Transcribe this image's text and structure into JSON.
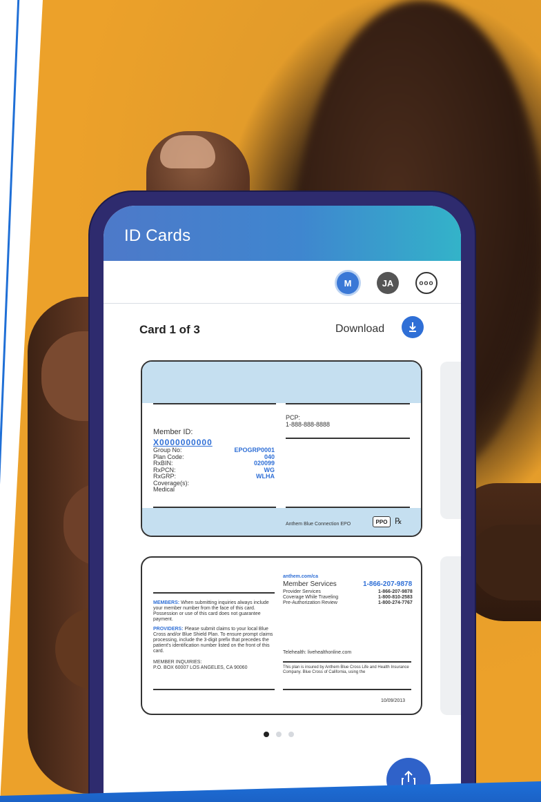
{
  "app": {
    "title": "ID Cards"
  },
  "members": {
    "items": [
      {
        "initials": "M",
        "selected": true
      },
      {
        "initials": "JA",
        "selected": false
      }
    ],
    "more_label": "ooo"
  },
  "card_nav": {
    "counter": "Card 1 of 3",
    "download_label": "Download"
  },
  "card_front": {
    "member_id_label": "Member ID:",
    "member_id_value": "X0000000000",
    "fields": [
      {
        "label": "Group No:",
        "value": "EPOGRP0001"
      },
      {
        "label": "Plan Code:",
        "value": "040"
      },
      {
        "label": "RxBIN:",
        "value": "020099"
      },
      {
        "label": "RxPCN:",
        "value": "WG"
      },
      {
        "label": "RxGRP:",
        "value": "WLHA"
      },
      {
        "label": "Coverage(s):",
        "value": ""
      },
      {
        "label": "Medical",
        "value": ""
      }
    ],
    "pcp_label": "PCP:",
    "pcp_phone": "1-888-888-8888",
    "plan_name": "Anthem Blue Connection EPO",
    "ppo_label": "PPO",
    "rx_label": "℞"
  },
  "card_back": {
    "website": "anthem.com/ca",
    "member_services_label": "Member Services",
    "member_services_phone": "1-866-207-9878",
    "services": [
      {
        "label": "Provider Services",
        "phone": "1-866-207-9878"
      },
      {
        "label": "Coverage While Traveling",
        "phone": "1-800-810-2583"
      },
      {
        "label": "Pre-Authorization Review",
        "phone": "1-800-274-7767"
      }
    ],
    "members_heading": "MEMBERS:",
    "members_text": "When submitting inquiries always include your member number from the face of this card. Possession or use of this card does not guarantee payment.",
    "providers_heading": "PROVIDERS:",
    "providers_text": "Please submit claims to your local Blue Cross and/or Blue Shield Plan. To ensure prompt claims processing, include the 3-digit prefix that precedes the patient's identification number listed on the front of this card.",
    "inquiries_label": "MEMBER INQUIRIES:",
    "inquiries_address": "P.O. BOX 60007 LOS ANGELES, CA 90060",
    "telehealth": "Telehealth: livehealthonline.com",
    "insured_text": "This plan is insured by Anthem Blue Cross Life and Health Insurance Company. Blue Cross of California, using the",
    "date": "10/09/2013"
  },
  "pagination": {
    "total": 3,
    "active": 1
  },
  "fab": {
    "icon": "share-icon"
  },
  "colors": {
    "brand_blue": "#2f6fd6",
    "phone_frame": "#2e2b6e",
    "appbar_start": "#4d79c9",
    "appbar_end": "#33b3c9",
    "card_band": "#c5dff0"
  }
}
